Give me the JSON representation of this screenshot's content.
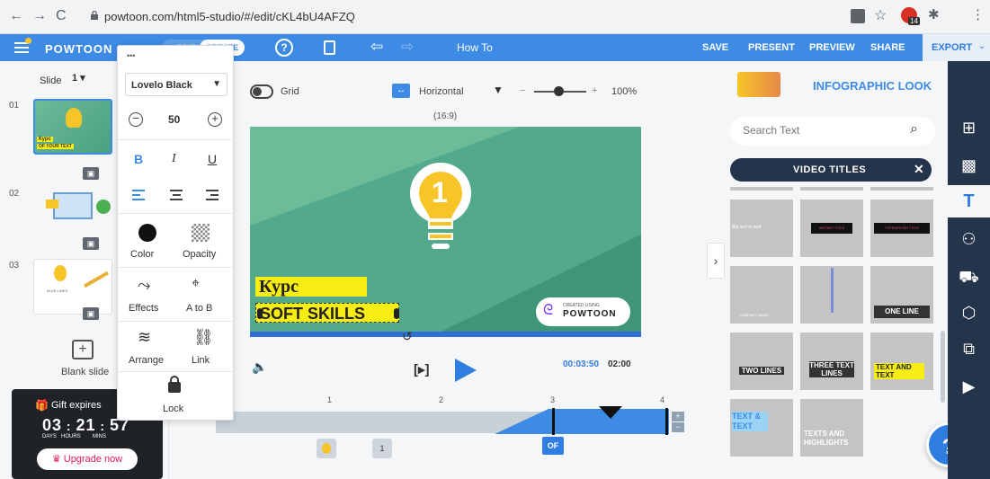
{
  "browser": {
    "url": "powtoon.com/html5-studio/#/edit/cKL4bU4AFZQ",
    "back": "←",
    "forward": "→",
    "reload": "C",
    "ext_badge": "14"
  },
  "toolbar": {
    "brand": "POWTOON",
    "edit_label": "EDIT",
    "create_label": "CREATE",
    "help_glyph": "?",
    "how_to": "How To",
    "save": "SAVE",
    "present": "PRESENT",
    "preview": "PREVIEW",
    "share": "SHARE",
    "export": "EXPORT"
  },
  "left": {
    "slide_label": "Slide",
    "slide_select": "1",
    "slides": [
      {
        "num": "01",
        "title": "Курс",
        "sub": "OF YOUR TEXT"
      },
      {
        "num": "02"
      },
      {
        "num": "03",
        "caption": "BLUE LINES"
      }
    ],
    "blank_slide": "Blank slide",
    "gift_text": "Gift expires",
    "countdown": {
      "days": "03",
      "hours": "21",
      "mins": "57",
      "days_label": "DAYS",
      "hours_label": "HOURS",
      "mins_label": "MINS"
    },
    "upgrade": "Upgrade now"
  },
  "popup": {
    "dots": "•••",
    "font": "Lovelo Black",
    "size": "50",
    "bold": "B",
    "italic": "I",
    "underline": "U",
    "color": "Color",
    "opacity": "Opacity",
    "effects": "Effects",
    "atob": "A to B",
    "arrange": "Arrange",
    "link": "Link",
    "lock": "Lock"
  },
  "canvas_bar": {
    "grid": "Grid",
    "orientation": "Horizontal",
    "ratio": "(16:9)",
    "zoom": "100%",
    "zoom_minus": "−",
    "zoom_plus": "+"
  },
  "canvas": {
    "number": "1",
    "title": "Курс",
    "subtitle": "SOFT SKILLS",
    "created_using": "CREATED USING",
    "brand": "POWTOON"
  },
  "player": {
    "play_bracket": "[▸]",
    "current_time": "00:03:50",
    "total_time": "02:00"
  },
  "timeline": {
    "ticks": [
      "1",
      "2",
      "3",
      "4"
    ],
    "item_label": "1",
    "of_label": "OF"
  },
  "right": {
    "look_title": "INFOGRAPHIC LOOK",
    "search_placeholder": "Search Text",
    "category": "VIDEO TITLES",
    "tiles": [
      {
        "text": "Big and to and"
      },
      {
        "text": "INSTANT TITLE"
      },
      {
        "text": "TYPEWRITER TITLE"
      },
      {
        "text": "COMPANY NAME"
      },
      {
        "text": ""
      },
      {
        "text": "ONE LINE"
      },
      {
        "text": "TWO LINES"
      },
      {
        "text": "THREE TEXT LINES"
      },
      {
        "text": "TEXT AND TEXT"
      },
      {
        "text": "TEXT & TEXT"
      },
      {
        "text": "TEXTS AND HIGHLIGHTS"
      }
    ],
    "help": "?"
  },
  "colors": {
    "toolbar_blue": "#3d8be5",
    "canvas_green": "#52a98b",
    "highlight_yellow": "#f7ec13",
    "sidebar_navy": "#24344a",
    "export_blue": "#2f7de1"
  }
}
